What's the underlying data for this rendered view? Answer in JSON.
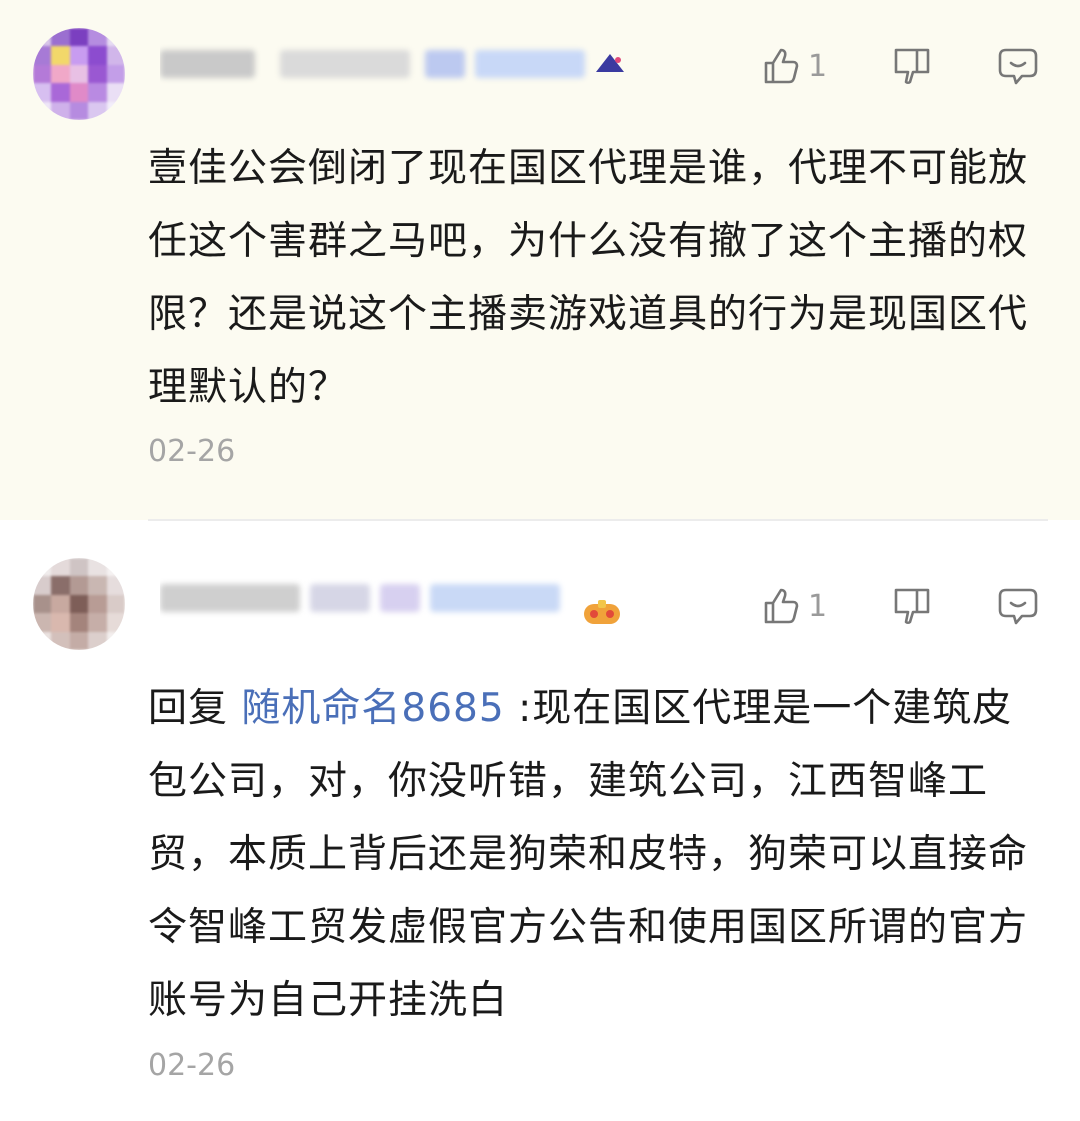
{
  "comments": [
    {
      "username": "",
      "like_count": "1",
      "text": "壹佳公会倒闭了现在国区代理是谁，代理不可能放任这个害群之马吧，为什么没有撤了这个主播的权限？还是说这个主播卖游戏道具的行为是现国区代理默认的？",
      "date": "02-26"
    },
    {
      "username": "",
      "like_count": "1",
      "reply_prefix": "回复 ",
      "reply_to": "随机命名8685",
      "text": " :现在国区代理是一个建筑皮包公司，对，你没听错，建筑公司，江西智峰工贸，本质上背后还是狗荣和皮特，狗荣可以直接命令智峰工贸发虚假官方公告和使用国区所谓的官方账号为自己开挂洗白",
      "date": "02-26"
    }
  ],
  "icons": {
    "like": "thumb-up-icon",
    "dislike": "thumb-down-icon",
    "reply": "comment-bubble-icon"
  },
  "colors": {
    "mention": "#4a6fb8",
    "muted": "#a5a5a5",
    "first_bg": "#fcfbf1"
  }
}
